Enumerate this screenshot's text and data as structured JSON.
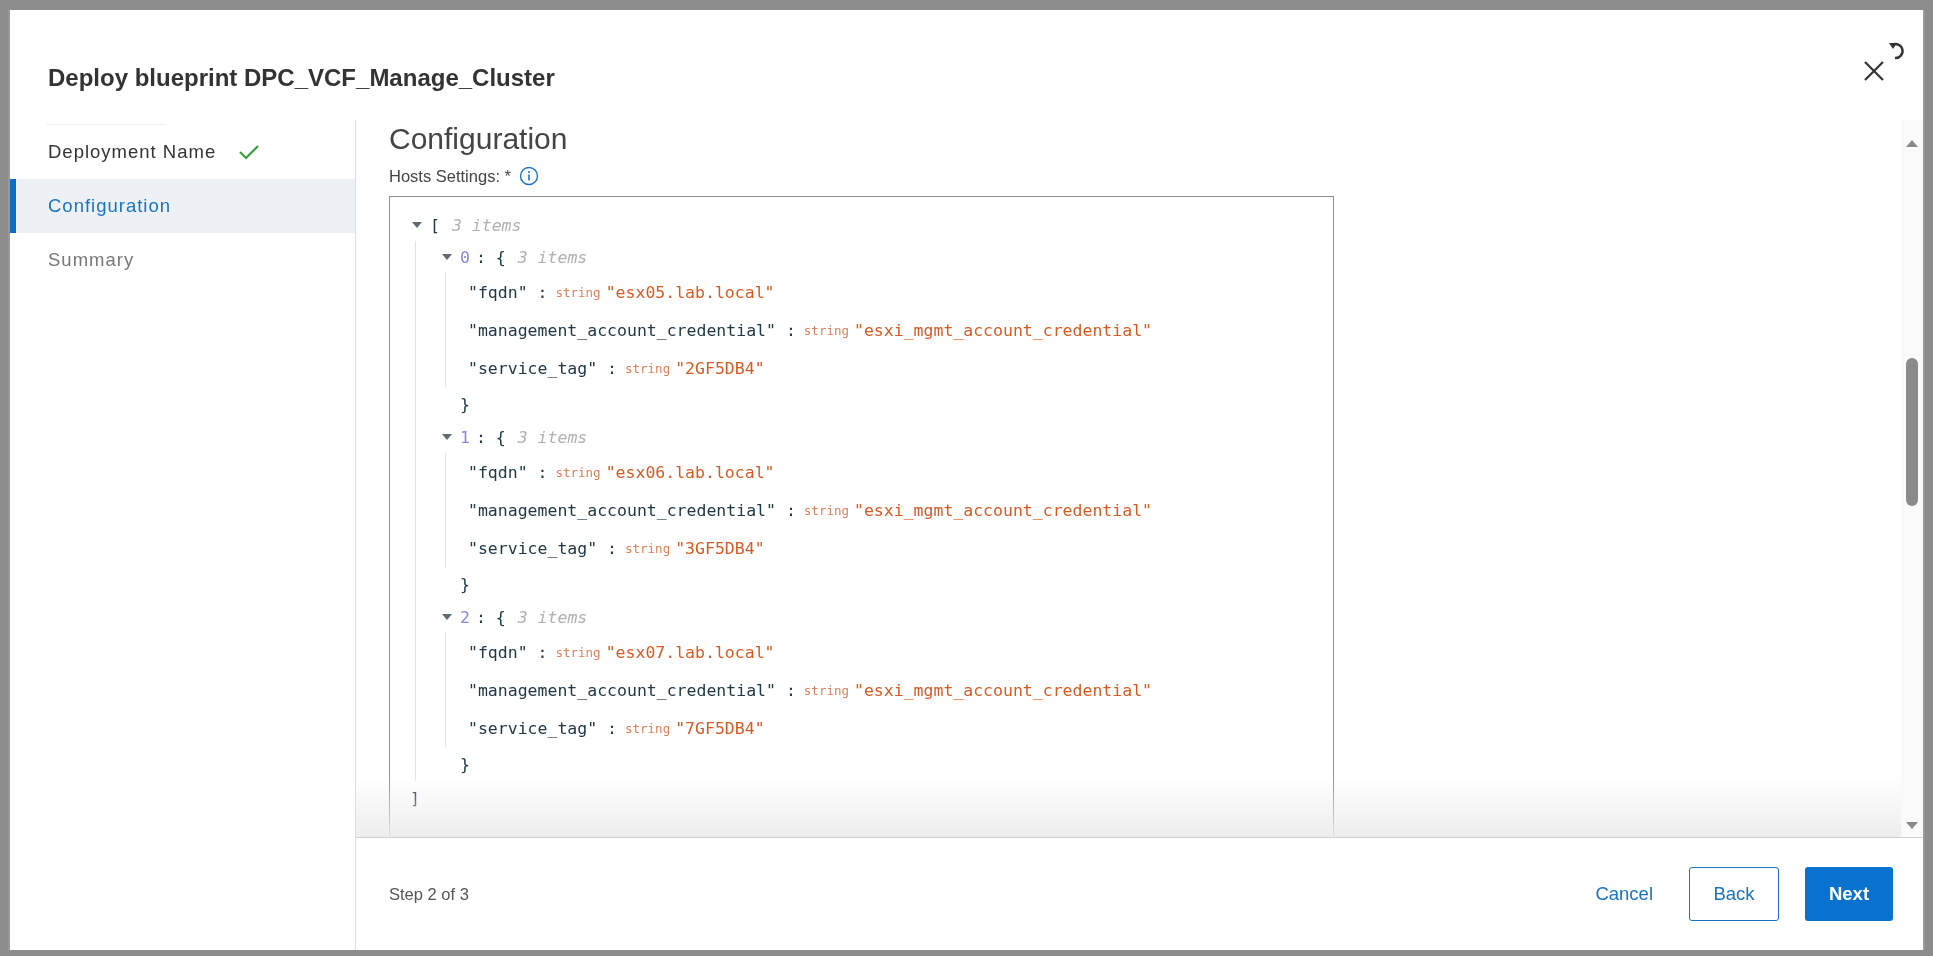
{
  "dialog": {
    "title": "Deploy blueprint DPC_VCF_Manage_Cluster"
  },
  "steps": [
    {
      "label": "Deployment Name",
      "selected": false,
      "completed": true,
      "disabled": false
    },
    {
      "label": "Configuration",
      "selected": true,
      "completed": false,
      "disabled": false
    },
    {
      "label": "Summary",
      "selected": false,
      "completed": false,
      "disabled": true
    }
  ],
  "content": {
    "heading": "Configuration",
    "field_label": "Hosts Settings: *"
  },
  "tree": {
    "open": "[",
    "count": "3 items",
    "expanded": true,
    "close": "]",
    "children": [
      {
        "index": "0",
        "open": ": {",
        "count": "3 items",
        "expanded": true,
        "close": "}",
        "entries": [
          {
            "key": "\"fqdn\" :",
            "type": "string",
            "value": "\"esx05.lab.local\""
          },
          {
            "key": "\"management_account_credential\" :",
            "type": "string",
            "value": "\"esxi_mgmt_account_credential\""
          },
          {
            "key": "\"service_tag\" :",
            "type": "string",
            "value": "\"2GF5DB4\""
          }
        ]
      },
      {
        "index": "1",
        "open": ": {",
        "count": "3 items",
        "expanded": true,
        "close": "}",
        "entries": [
          {
            "key": "\"fqdn\" :",
            "type": "string",
            "value": "\"esx06.lab.local\""
          },
          {
            "key": "\"management_account_credential\" :",
            "type": "string",
            "value": "\"esxi_mgmt_account_credential\""
          },
          {
            "key": "\"service_tag\" :",
            "type": "string",
            "value": "\"3GF5DB4\""
          }
        ]
      },
      {
        "index": "2",
        "open": ": {",
        "count": "3 items",
        "expanded": true,
        "close": "}",
        "entries": [
          {
            "key": "\"fqdn\" :",
            "type": "string",
            "value": "\"esx07.lab.local\""
          },
          {
            "key": "\"management_account_credential\" :",
            "type": "string",
            "value": "\"esxi_mgmt_account_credential\""
          },
          {
            "key": "\"service_tag\" :",
            "type": "string",
            "value": "\"7GF5DB4\""
          }
        ]
      }
    ]
  },
  "footer": {
    "step": "Step 2 of 3",
    "buttons": [
      {
        "label": "Cancel",
        "kind": "link"
      },
      {
        "label": "Back",
        "kind": "outline"
      },
      {
        "label": "Next",
        "kind": "primary"
      }
    ]
  }
}
